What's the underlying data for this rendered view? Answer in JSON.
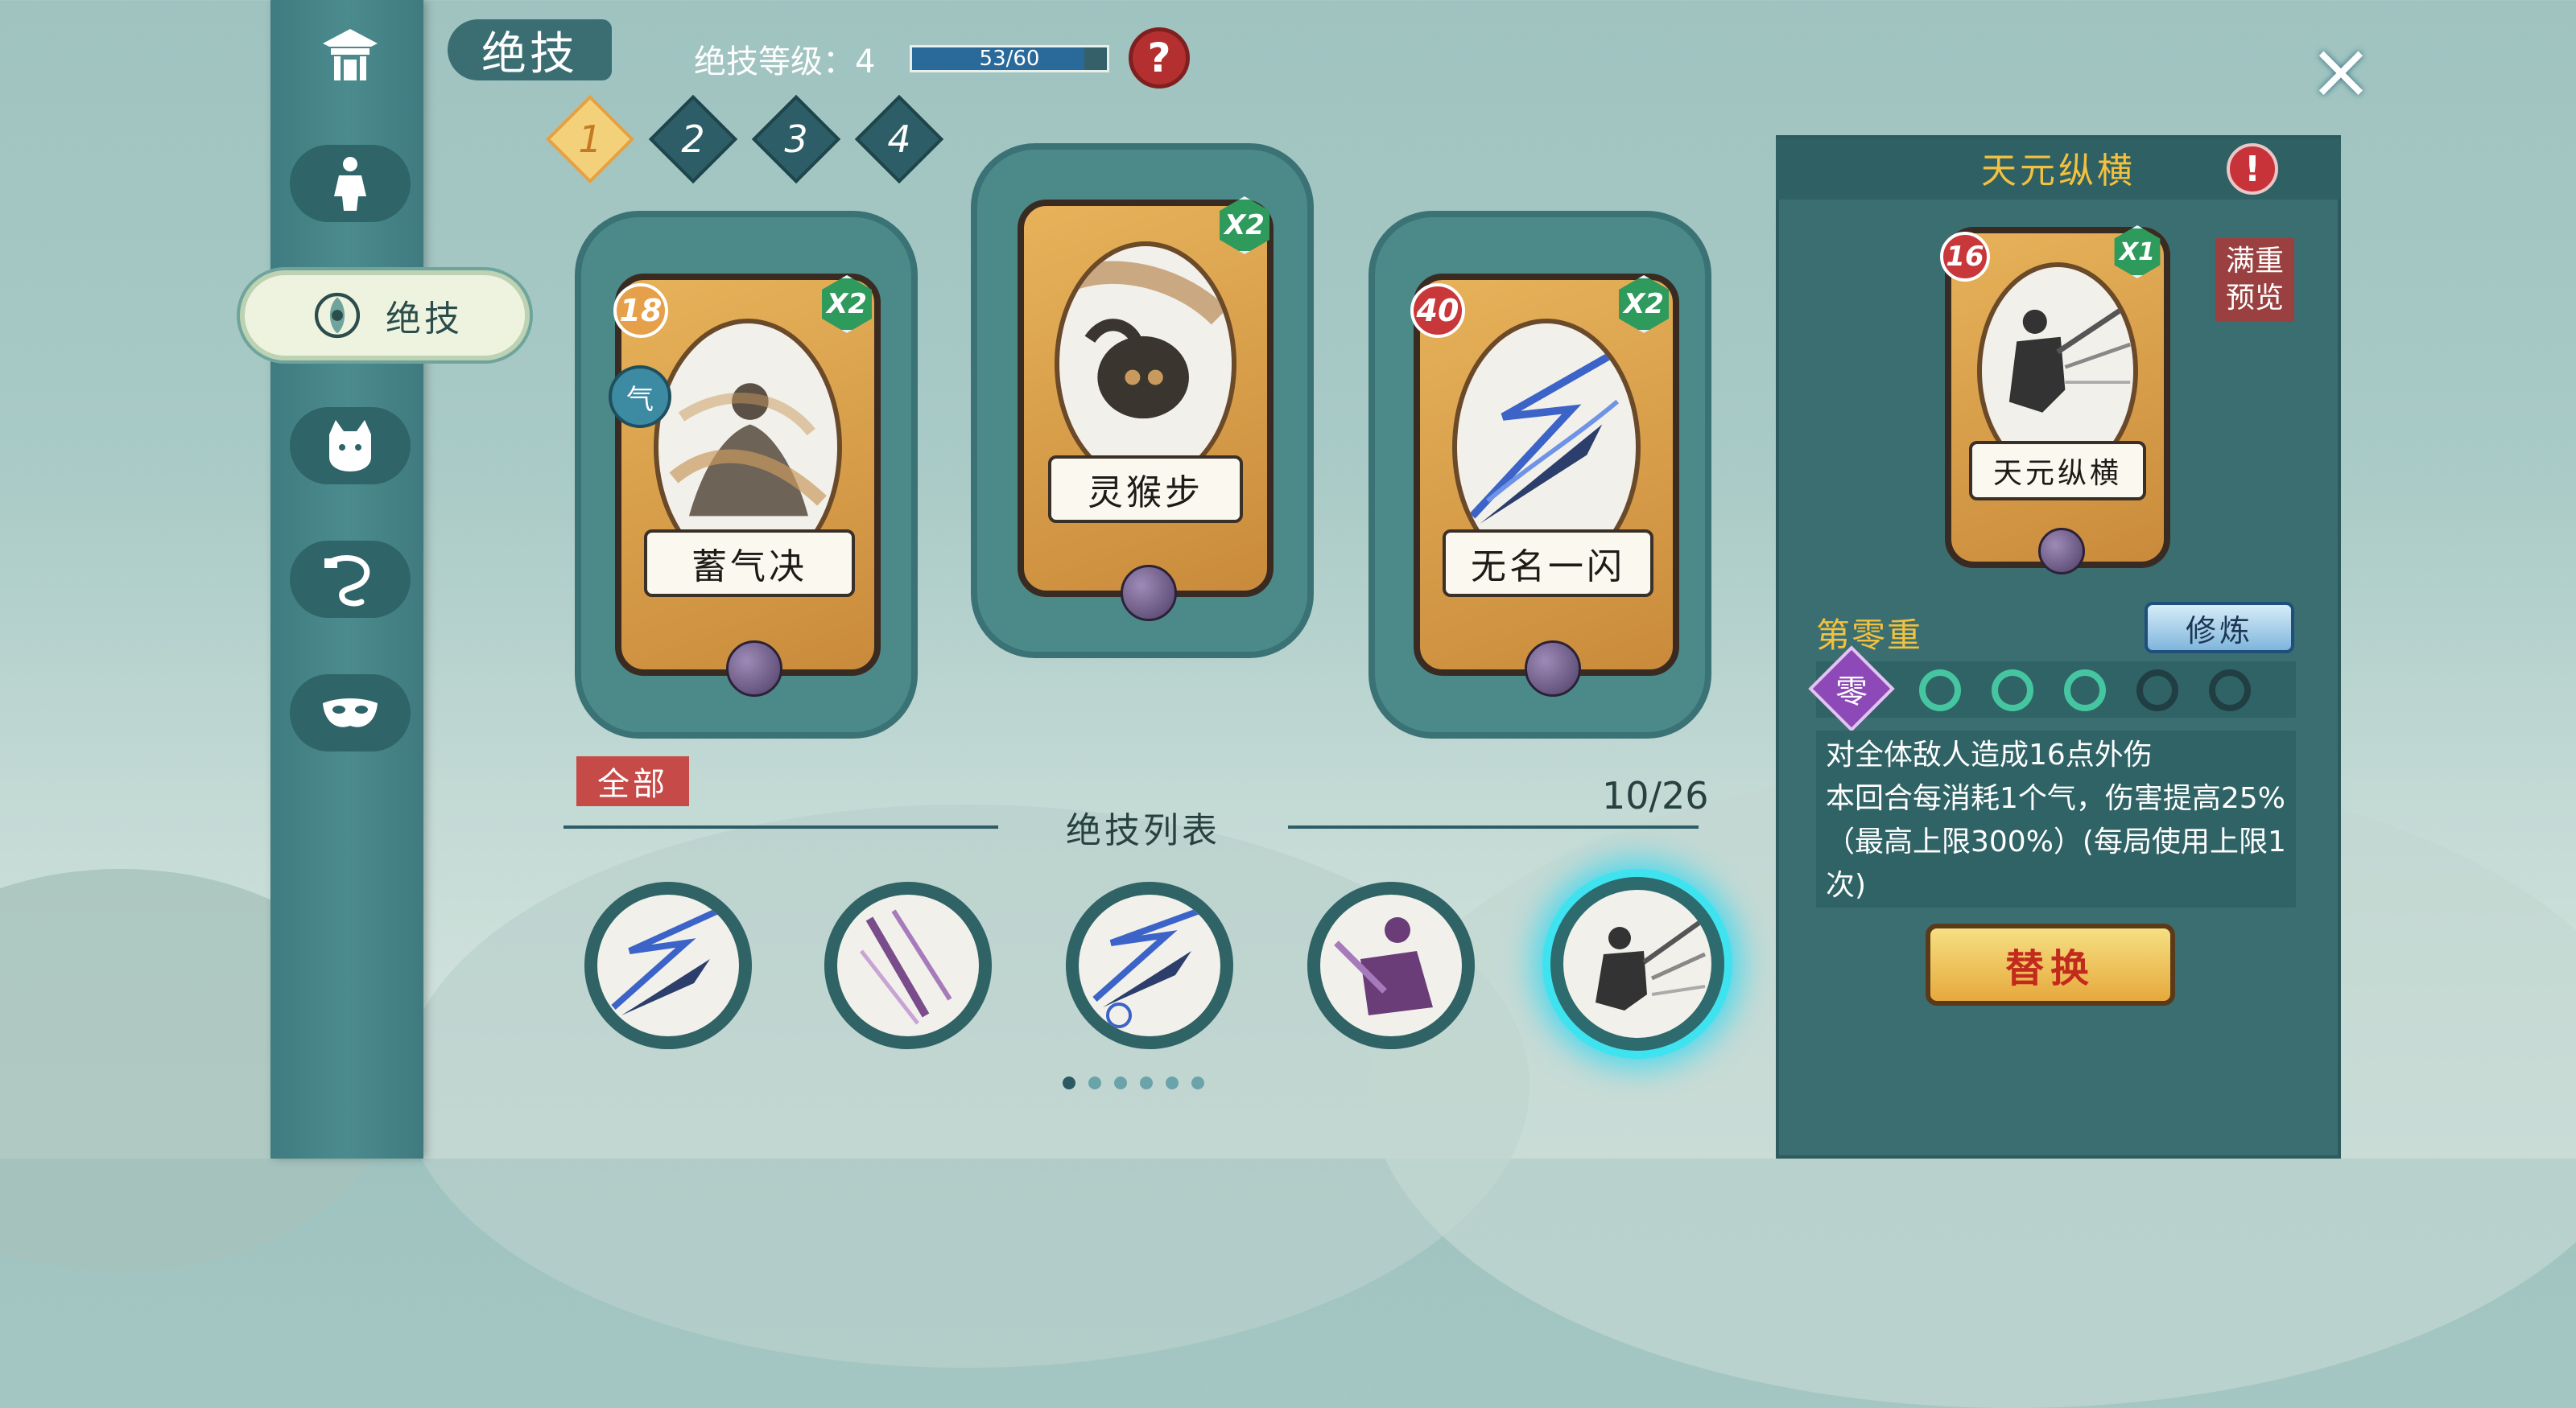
{
  "header": {
    "title": "绝技",
    "level_label": "绝技等级：4",
    "progress_text": "53/60",
    "progress_fraction": 0.883,
    "help_icon": "?"
  },
  "close_icon": "×",
  "sidebar": {
    "items": [
      {
        "name": "pavilion-icon"
      },
      {
        "name": "martial-artist-icon"
      },
      {
        "name": "skill-emblem-icon",
        "label": "绝技",
        "active": true
      },
      {
        "name": "cat-icon"
      },
      {
        "name": "whip-icon"
      },
      {
        "name": "mask-icon"
      }
    ]
  },
  "level_tabs": [
    "1",
    "2",
    "3",
    "4"
  ],
  "equipped": [
    {
      "name": "蓄气决",
      "cost": "18",
      "mult": "X2",
      "qi_badge": "气"
    },
    {
      "name": "灵猴步",
      "cost": "",
      "mult": "X2"
    },
    {
      "name": "无名一闪",
      "cost": "40",
      "mult": "X2"
    }
  ],
  "list": {
    "filter": "全部",
    "title": "绝技列表",
    "count": "10/26",
    "page_dots": 6,
    "active_page": 1
  },
  "panel": {
    "title": "天元纵横",
    "alert": "!",
    "card_name": "天元纵横",
    "cost": "16",
    "mult": "X1",
    "preview": [
      "满重",
      "预览"
    ],
    "tier": "第零重",
    "train": "修炼",
    "tier_gem": "零",
    "description": "对全体敌人造成16点外伤\n本回合每消耗1个气，伤害提高25%（最高上限300%）(每局使用上限1次)",
    "swap": "替换"
  },
  "colors": {
    "gold": "#f2c13f",
    "panel": "#3b6e71",
    "card_gold": "#e7b25a",
    "selected_glow": "#45d8ee",
    "red": "#c8373a"
  }
}
